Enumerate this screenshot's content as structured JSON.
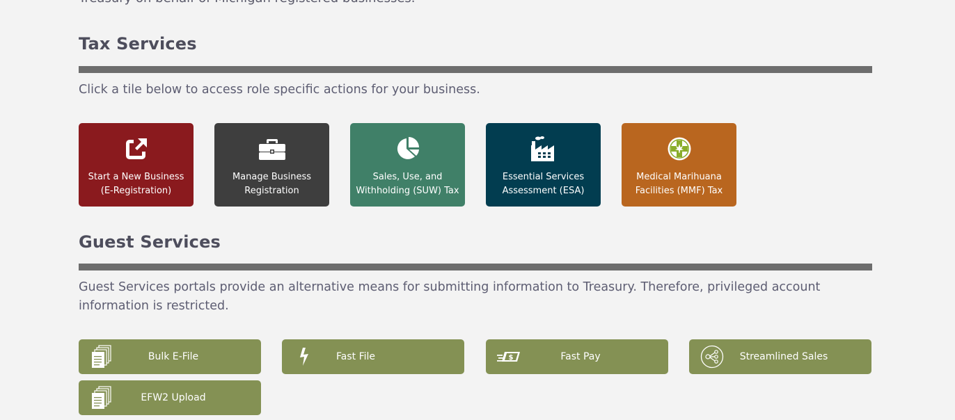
{
  "intro": {
    "clipped_text": "Treasury on behalf of Michigan registered businesses."
  },
  "tax_services": {
    "title": "Tax Services",
    "description": "Click a tile below to access role specific actions for your business.",
    "tiles": [
      {
        "line1": "Start a New Business",
        "line2": "(E-Registration)",
        "icon": "external-link-icon",
        "color": "#8a1a1e"
      },
      {
        "line1": "Manage Business",
        "line2": "Registration",
        "icon": "briefcase-icon",
        "color": "#3e3e3e"
      },
      {
        "line1": "Sales, Use, and",
        "line2": "Withholding (SUW) Tax",
        "icon": "pie-chart-icon",
        "color": "#408068"
      },
      {
        "line1": "Essential Services",
        "line2": "Assessment (ESA)",
        "icon": "factory-icon",
        "color": "#023d50"
      },
      {
        "line1": "Medical Marihuana",
        "line2": "Facilities (MMF) Tax",
        "icon": "medical-cross-leaf-icon",
        "color": "#b9661f"
      }
    ]
  },
  "guest_services": {
    "title": "Guest Services",
    "description": "Guest Services portals provide an alternative means for submitting information to Treasury. Therefore, privileged account information is restricted.",
    "buttons": [
      {
        "label": "Bulk E-File",
        "icon": "documents-stack-icon"
      },
      {
        "label": "Fast File",
        "icon": "lightning-bolt-icon"
      },
      {
        "label": "Fast Pay",
        "icon": "fast-dollar-icon"
      },
      {
        "label": "Streamlined Sales",
        "icon": "share-nodes-icon"
      },
      {
        "label": "EFW2 Upload",
        "icon": "documents-stack-icon"
      }
    ],
    "button_color": "#849154"
  }
}
